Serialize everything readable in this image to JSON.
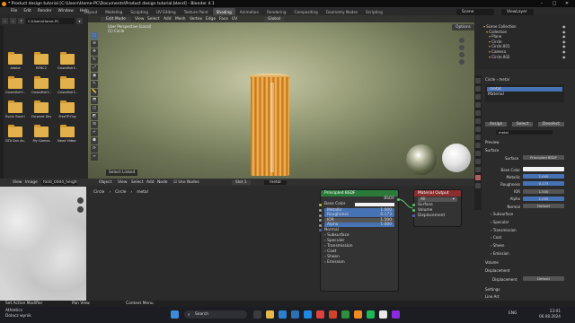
{
  "app": {
    "title": "* Product design tutorial [C:\\Users\\Home-PC\\Documents\\Product design tutorial.blend] - Blender 4.1"
  },
  "menu": [
    "File",
    "Edit",
    "Render",
    "Window",
    "Help",
    "Select"
  ],
  "workspace_tabs": [
    "Layout",
    "Modeling",
    "Sculpting",
    "UV Editing",
    "Texture Paint",
    "Shading",
    "Animation",
    "Rendering",
    "Compositing",
    "Geometry Nodes",
    "Scripting"
  ],
  "active_tab": "Shading",
  "scene": "Scene",
  "view_layer": "ViewLayer",
  "file_browser": {
    "path": "C:\\Users\\Home-PC",
    "folders": [
      "Adobe",
      "BFBC2",
      "ClownfishY...",
      "ClownfishY...",
      "ClownfishY...",
      "ClownfishY...",
      "Evolv Track E...",
      "Forward Dev...",
      "FreeTP.Org",
      "GTA San An...",
      "My Games",
      "Newt Video s..."
    ]
  },
  "viewport": {
    "mode": "Edit Mode",
    "menus": [
      "View",
      "Select",
      "Add",
      "Mesh",
      "Vertex",
      "Edge",
      "Face",
      "UV"
    ],
    "orientation": "Global",
    "info": [
      "User Perspective (Local)",
      "(1) Circle"
    ],
    "options": "Options",
    "select_linked": "Select Linked"
  },
  "image_editor": {
    "menus": [
      "View",
      "Image"
    ],
    "image": "food_0004_height_1k"
  },
  "node_editor": {
    "menus": [
      "Object",
      "View",
      "Select",
      "Add",
      "Node"
    ],
    "use_nodes": "Use Nodes",
    "slot": "Slot 1",
    "material": "metal",
    "breadcrumb": [
      "Circle",
      "Circle",
      "metal"
    ],
    "bsdf": {
      "title": "Principled BSDF",
      "out": "BSDF",
      "base_color": "Base Color",
      "fields": [
        {
          "label": "Metallic",
          "value": "1.000",
          "active": true
        },
        {
          "label": "Roughness",
          "value": "0.173",
          "active": true
        },
        {
          "label": "IOR",
          "value": "1.500",
          "active": false
        },
        {
          "label": "Alpha",
          "value": "1.000",
          "active": true
        }
      ],
      "normal": "Normal",
      "sections": [
        "Subsurface",
        "Specular",
        "Transmission",
        "Coat",
        "Sheen",
        "Emission"
      ]
    },
    "output": {
      "title": "Material Output",
      "target": "All",
      "inputs": [
        "Surface",
        "Volume",
        "Displacement"
      ]
    }
  },
  "outliner": {
    "items": [
      "Scene Collection",
      "Collection",
      "Plane",
      "Circle",
      "Circle.001",
      "Camera",
      "Circle.002"
    ]
  },
  "properties": {
    "breadcrumb": [
      "Circle",
      "metal"
    ],
    "slots": [
      "metal",
      "Material"
    ],
    "actions": [
      "Assign",
      "Select",
      "Deselect"
    ],
    "material_name": "metal",
    "preview": "Preview",
    "surface": "Surface",
    "surface_shader": "Principled BSDF",
    "rows": [
      {
        "label": "Base Color",
        "value": "",
        "type": "color"
      },
      {
        "label": "Metallic",
        "value": "1.000",
        "type": "blue"
      },
      {
        "label": "Roughness",
        "value": "0.173",
        "type": "blue"
      },
      {
        "label": "IOR",
        "value": "1.500",
        "type": "grey"
      },
      {
        "label": "Alpha",
        "value": "1.000",
        "type": "blue"
      },
      {
        "label": "Normal",
        "value": "Default",
        "type": "grey"
      }
    ],
    "sections": [
      "Subsurface",
      "Specular",
      "Transmission",
      "Coat",
      "Sheen",
      "Emission"
    ],
    "volume": "Volume",
    "displacement": "Displacement",
    "disp_value": "Default",
    "settings": "Settings",
    "lineart": "Line Art"
  },
  "statusbar": {
    "left": "Set Active Modifier",
    "mid": "Pan View",
    "right": "Context Menu"
  },
  "taskbar": {
    "weather_title": "Athletics",
    "weather_sub": "Dolacz wynik",
    "search_placeholder": "Search",
    "lang": "ENG",
    "time": "23:01",
    "date": "06.08.2024"
  }
}
